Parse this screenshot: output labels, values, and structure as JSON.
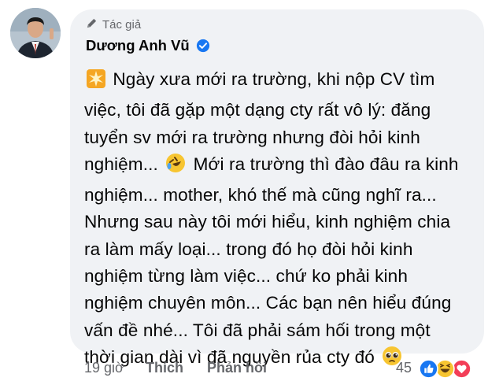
{
  "comment": {
    "author_badge": "Tác giả",
    "author_name": "Dương Anh Vũ",
    "lines": [
      "Ngày xưa mới ra trường, khi nộp CV tìm",
      "việc, tôi đã gặp một dạng cty rất vô lý: đăng",
      "tuyển sv mới ra trường nhưng đòi hỏi kinh",
      "nghiệm...",
      "Mới ra trường thì đào đâu ra kinh",
      "nghiệm... mother, khó thế mà cũng nghĩ ra...",
      "Nhưng sau này tôi mới hiểu, kinh nghiệm chia",
      "ra làm mấy loại... trong đó họ đòi hỏi kinh",
      "nghiệm từng làm việc... chứ ko phải kinh",
      "nghiệm chuyên môn... Các bạn nên hiểu đúng",
      "vấn đề nhé... Tôi đã phải sám hối trong một",
      "thời gian dài vì đã nguyền rủa cty đó"
    ],
    "emojis": [
      "sparkle-emoji",
      "rofl-emoji",
      "pleading-emoji"
    ]
  },
  "footer": {
    "time": "19 giờ",
    "like_label": "Thích",
    "reply_label": "Phản hồi",
    "reaction_count": "45",
    "reactions": [
      "like",
      "haha",
      "love"
    ]
  },
  "colors": {
    "bubble_bg": "#f0f2f5",
    "text_primary": "#050505",
    "text_secondary": "#65676b",
    "verified_blue": "#1877f2",
    "love_red": "#f33e58"
  }
}
